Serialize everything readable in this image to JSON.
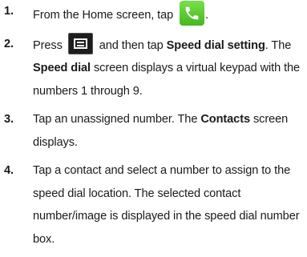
{
  "steps": [
    {
      "number": "1.",
      "text_before_icon": "From the Home screen, tap",
      "icon": "phone-icon",
      "text_after_icon": "."
    },
    {
      "number": "2.",
      "text_a": "Press",
      "icon": "menu-icon",
      "text_b": "and then tap",
      "bold_1": "Speed dial setting",
      "text_c": ". The",
      "bold_2": "Speed dial",
      "text_d": "screen displays a virtual keypad with the numbers 1 through 9."
    },
    {
      "number": "3.",
      "text_a": "Tap an unassigned number. The",
      "bold_1": "Contacts",
      "text_b": "screen displays."
    },
    {
      "number": "4.",
      "text": "Tap a contact and select a number to assign to the speed dial location. The selected contact number/image is displayed in the speed dial number box."
    }
  ],
  "colors": {
    "phone_icon_green": "#5ccb2e",
    "menu_icon_bg": "#1d1d1d"
  }
}
